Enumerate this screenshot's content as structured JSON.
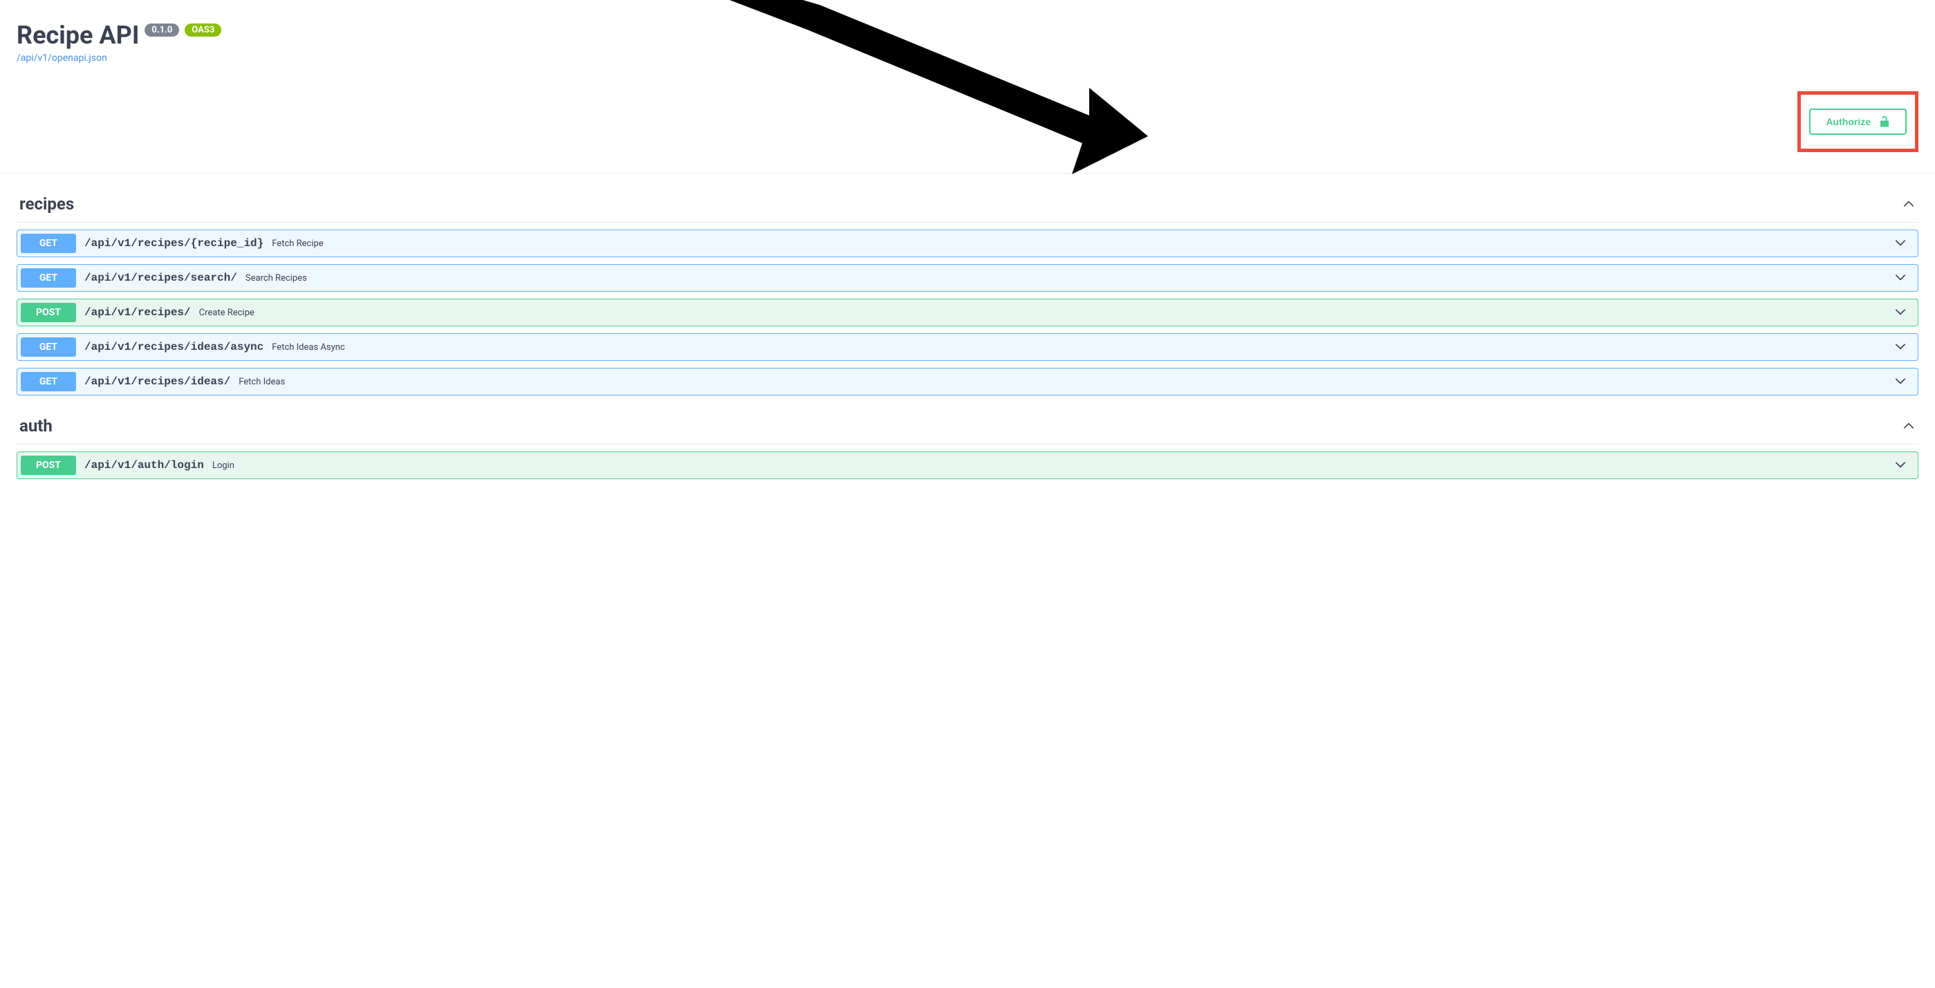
{
  "header": {
    "title": "Recipe API",
    "version": "0.1.0",
    "oas": "OAS3",
    "spec_link": "/api/v1/openapi.json"
  },
  "authorize": {
    "label": "Authorize"
  },
  "tags": [
    {
      "name": "recipes",
      "operations": [
        {
          "method": "GET",
          "path": "/api/v1/recipes/{recipe_id}",
          "summary": "Fetch Recipe"
        },
        {
          "method": "GET",
          "path": "/api/v1/recipes/search/",
          "summary": "Search Recipes"
        },
        {
          "method": "POST",
          "path": "/api/v1/recipes/",
          "summary": "Create Recipe"
        },
        {
          "method": "GET",
          "path": "/api/v1/recipes/ideas/async",
          "summary": "Fetch Ideas Async"
        },
        {
          "method": "GET",
          "path": "/api/v1/recipes/ideas/",
          "summary": "Fetch Ideas"
        }
      ]
    },
    {
      "name": "auth",
      "operations": [
        {
          "method": "POST",
          "path": "/api/v1/auth/login",
          "summary": "Login"
        }
      ]
    }
  ]
}
